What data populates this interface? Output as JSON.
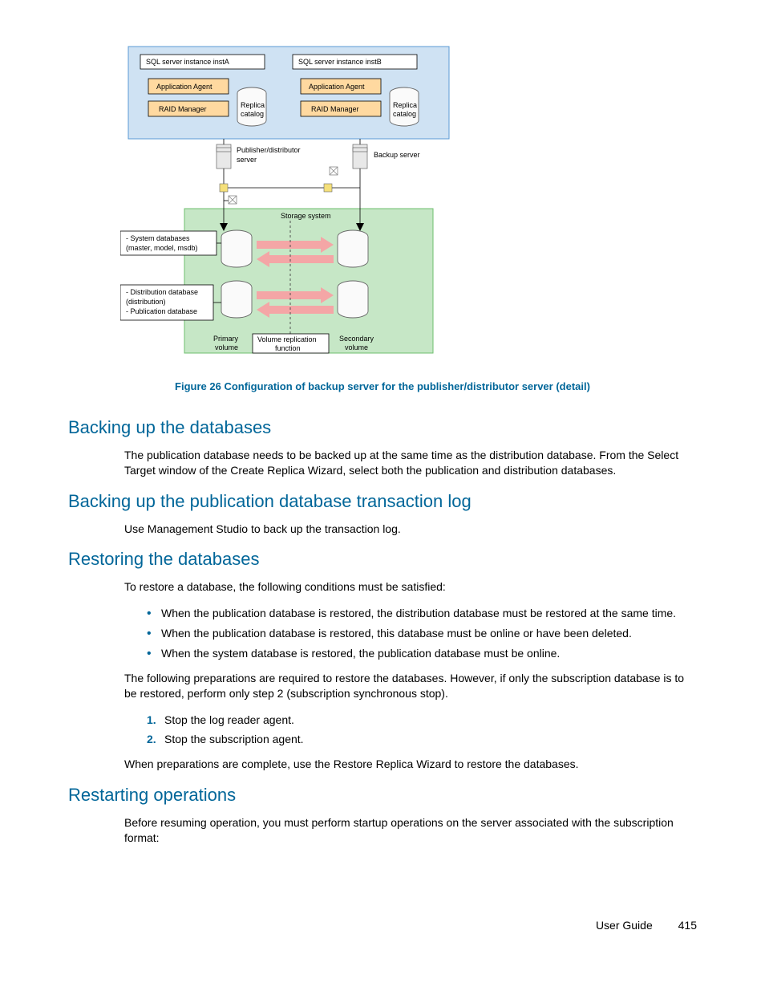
{
  "figure": {
    "caption": "Figure 26 Configuration of backup server for the publisher/distributor server (detail)",
    "nodes": {
      "instA_title": "SQL server instance instA",
      "instB_title": "SQL server instance instB",
      "app_agent": "Application Agent",
      "raid_mgr": "RAID Manager",
      "replica_catalog_l1": "Replica",
      "replica_catalog_l2": "catalog",
      "pub_dist_l1": "Publisher/distributor",
      "pub_dist_l2": "server",
      "backup_server": "Backup server",
      "storage_system": "Storage system",
      "sys_db_l1": "- System databases",
      "sys_db_l2": "  (master, model, msdb)",
      "dist_db_l1": "- Distribution database",
      "dist_db_l2": "  (distribution)",
      "dist_db_l3": "- Publication database",
      "primary_vol_l1": "Primary",
      "primary_vol_l2": "volume",
      "vol_repl_l1": "Volume replication",
      "vol_repl_l2": "function",
      "secondary_vol_l1": "Secondary",
      "secondary_vol_l2": "volume"
    }
  },
  "sections": {
    "s1": {
      "title": "Backing up the databases",
      "p1": "The publication database needs to be backed up at the same time as the distribution database. From the Select Target window of the Create Replica Wizard, select both the publication and distribution databases."
    },
    "s2": {
      "title": "Backing up the publication database transaction log",
      "p1": "Use Management Studio to back up the transaction log."
    },
    "s3": {
      "title": "Restoring the databases",
      "p1": "To restore a database, the following conditions must be satisfied:",
      "b1": "When the publication database is restored, the distribution database must be restored at the same time.",
      "b2": "When the publication database is restored, this database must be online or have been deleted.",
      "b3": "When the system database is restored, the publication database must be online.",
      "p2": "The following preparations are required to restore the databases. However, if only the subscription database is to be restored, perform only step 2 (subscription synchronous stop).",
      "step1": "Stop the log reader agent.",
      "step2": "Stop the subscription agent.",
      "p3": "When preparations are complete, use the Restore Replica Wizard to restore the databases."
    },
    "s4": {
      "title": "Restarting operations",
      "p1": "Before resuming operation, you must perform startup operations on the server associated with the subscription format:"
    }
  },
  "footer": {
    "label": "User Guide",
    "page": "415"
  }
}
